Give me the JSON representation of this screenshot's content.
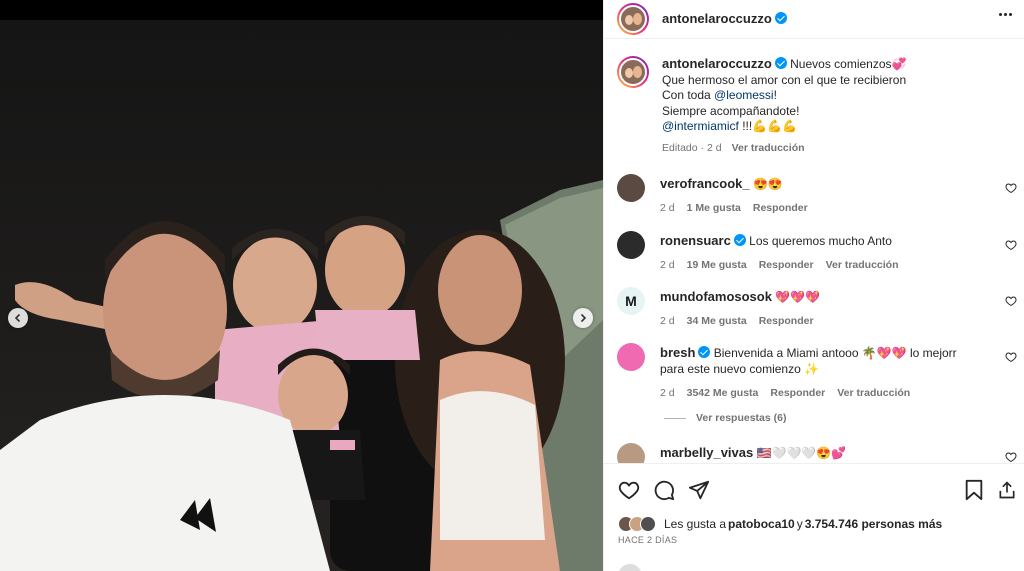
{
  "post": {
    "username": "antonelaroccuzzo",
    "caption_text": "Nuevos comienzos💞",
    "caption_line2": "Que hermoso el amor con el que te recibieron",
    "caption_line3_prefix": "Con toda ",
    "caption_mention1": "@leomessi",
    "caption_line3_suffix": "!",
    "caption_line4": "Siempre acompañandote!",
    "caption_mention2": "@intermiamicf",
    "caption_line5_suffix": " !!!💪💪💪",
    "caption_meta_edited": "Editado",
    "caption_meta_dot": "·",
    "caption_meta_time": "2 d",
    "caption_meta_translate": "Ver traducción"
  },
  "comments": [
    {
      "username": "verofrancook_",
      "text": "😍😍",
      "time": "2 d",
      "likes": "1 Me gusta",
      "reply": "Responder",
      "translate": "",
      "verified": false,
      "avatar_color": "#5a4a42"
    },
    {
      "username": "ronensuarc",
      "text": "Los queremos mucho Anto",
      "time": "2 d",
      "likes": "19 Me gusta",
      "reply": "Responder",
      "translate": "Ver traducción",
      "verified": true,
      "avatar_color": "#2b2b2b"
    },
    {
      "username": "mundofamososok",
      "text": "💖💖💖",
      "time": "2 d",
      "likes": "34 Me gusta",
      "reply": "Responder",
      "translate": "",
      "verified": false,
      "avatar_color": "#e7f4f4"
    },
    {
      "username": "bresh",
      "text": "Bienvenida a Miami antooo 🌴💖💖 lo mejorr para este nuevo comienzo ✨",
      "time": "2 d",
      "likes": "3542 Me gusta",
      "reply": "Responder",
      "translate": "Ver traducción",
      "verified": true,
      "avatar_color": "#f06ab2"
    },
    {
      "username": "marbelly_vivas",
      "text": "🇺🇸🤍🤍🤍😍💕",
      "time": "",
      "likes": "",
      "reply": "",
      "translate": "",
      "verified": false,
      "avatar_color": "#b89a82"
    }
  ],
  "replies_label": "Ver respuestas (6)",
  "likes": {
    "prefix": "Les gusta a ",
    "user": "patoboca10",
    "middle": " y ",
    "count": "3.754.746 personas más"
  },
  "posted_ago": "HACE 2 DÍAS",
  "carousel": {
    "slides": 3,
    "active_index": 0
  },
  "colors": {
    "link": "#00376b",
    "verified": "#0095f6",
    "muted": "#737373",
    "ring_start": "#f9ce34",
    "ring_end": "#6228d7"
  }
}
